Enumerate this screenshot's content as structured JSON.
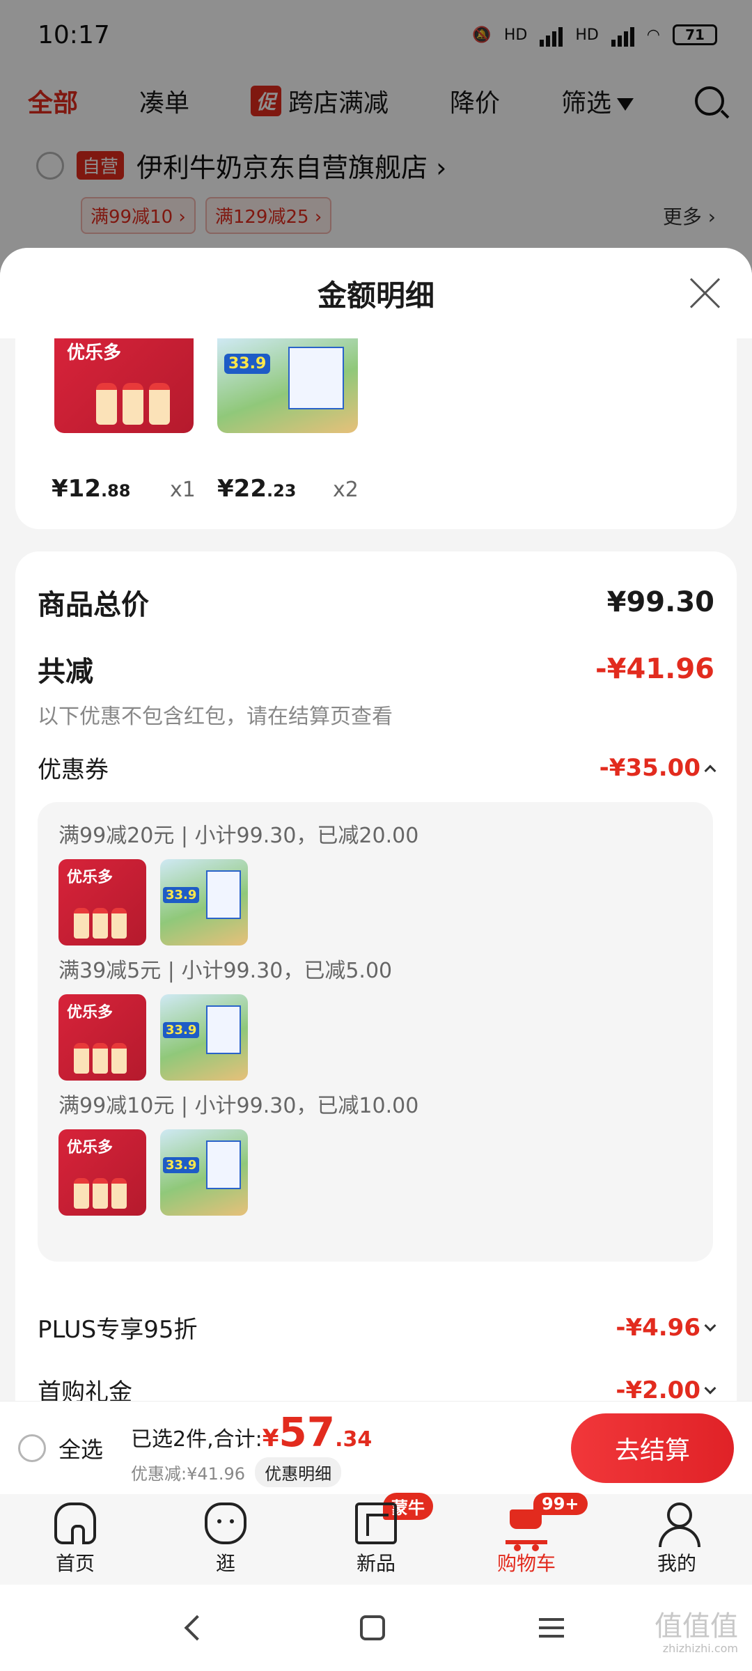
{
  "status": {
    "time": "10:17",
    "hd1": "HD",
    "hd2": "HD",
    "battery": "71"
  },
  "filters": {
    "all": "全部",
    "bundle": "凑单",
    "promo_badge": "促",
    "cross_store": "跨店满减",
    "price_drop": "降价",
    "filter": "筛选"
  },
  "store": {
    "self_badge": "自营",
    "name": "伊利牛奶京东自营旗舰店",
    "coupons": [
      "满99减10",
      "满129减25"
    ],
    "more": "更多"
  },
  "sheet": {
    "title": "金额明细",
    "products": [
      {
        "logo": "优乐多",
        "price_int": "¥12",
        "price_dec": ".88",
        "qty": "x1"
      },
      {
        "tag": "33.9",
        "price_int": "¥22",
        "price_dec": ".23",
        "qty": "x2"
      }
    ],
    "total_label": "商品总价",
    "total_value": "¥99.30",
    "reduce_label": "共减",
    "reduce_value": "-¥41.96",
    "reduce_note": "以下优惠不包含红包，请在结算页查看",
    "coupon_label": "优惠券",
    "coupon_value": "-¥35.00",
    "coupon_lines": [
      "满99减20元 | 小计99.30，已减20.00",
      "满39减5元 | 小计99.30，已减5.00",
      "满99减10元 | 小计99.30，已减10.00"
    ],
    "plus_label": "PLUS专享95折",
    "plus_value": "-¥4.96",
    "gift_label": "首购礼金",
    "gift_value": "-¥2.00"
  },
  "checkout": {
    "select_all": "全选",
    "selected_text": "已选2件,合计:",
    "currency": "¥",
    "amount_int": "57",
    "amount_dec": ".34",
    "discount_text": "优惠减:¥41.96",
    "detail_pill": "优惠明细",
    "button": "去结算"
  },
  "tabs": [
    {
      "label": "首页",
      "icon": "home-icon"
    },
    {
      "label": "逛",
      "icon": "face-icon"
    },
    {
      "label": "新品",
      "icon": "cube-icon",
      "badge": "蒙牛"
    },
    {
      "label": "购物车",
      "icon": "cart-icon",
      "badge": "99+"
    },
    {
      "label": "我的",
      "icon": "user-icon"
    }
  ],
  "watermark": {
    "main": "值值值",
    "sub": "zhizhizhi.com"
  },
  "colors": {
    "accent": "#e22b1e"
  }
}
